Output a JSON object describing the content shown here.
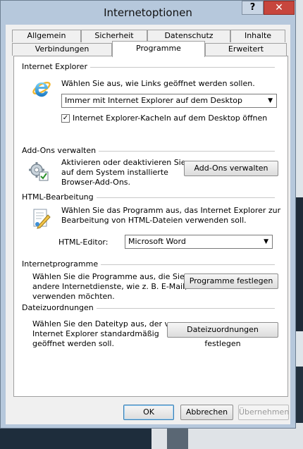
{
  "window": {
    "title": "Internetoptionen",
    "help_glyph": "?",
    "close_glyph": "✕"
  },
  "tabs_row1": [
    {
      "label": "Allgemein"
    },
    {
      "label": "Sicherheit"
    },
    {
      "label": "Datenschutz"
    },
    {
      "label": "Inhalte"
    }
  ],
  "tabs_row2": [
    {
      "label": "Verbindungen"
    },
    {
      "label": "Programme",
      "active": true
    },
    {
      "label": "Erweitert"
    }
  ],
  "internet_explorer": {
    "heading": "Internet Explorer",
    "description": "Wählen Sie aus, wie Links geöffnet werden sollen.",
    "select_value": "Immer mit Internet Explorer auf dem Desktop",
    "checkbox_label": "Internet Explorer-Kacheln auf dem Desktop öffnen",
    "checkbox_checked": true
  },
  "addons": {
    "heading": "Add-Ons verwalten",
    "description": [
      "Aktivieren oder deaktivieren Sie",
      "auf dem System installierte",
      "Browser-Add-Ons."
    ],
    "button": "Add-Ons verwalten"
  },
  "html_editing": {
    "heading": "HTML-Bearbeitung",
    "description": [
      "Wählen Sie das Programm aus, das Internet Explorer zur",
      "Bearbeitung von HTML-Dateien verwenden soll."
    ],
    "editor_label": "HTML-Editor:",
    "editor_value": "Microsoft Word"
  },
  "internet_programs": {
    "heading": "Internetprogramme",
    "description": [
      "Wählen Sie die Programme aus, die Sie für",
      "andere Internetdienste, wie z. B. E-Mail,",
      "verwenden möchten."
    ],
    "button": "Programme festlegen"
  },
  "file_associations": {
    "heading": "Dateizuordnungen",
    "description": [
      "Wählen Sie den Dateityp aus, der von",
      "Internet Explorer standardmäßig",
      "geöffnet werden soll."
    ],
    "button": "Dateizuordnungen festlegen"
  },
  "footer": {
    "ok": "OK",
    "cancel": "Abbrechen",
    "apply": "Übernehmen"
  }
}
